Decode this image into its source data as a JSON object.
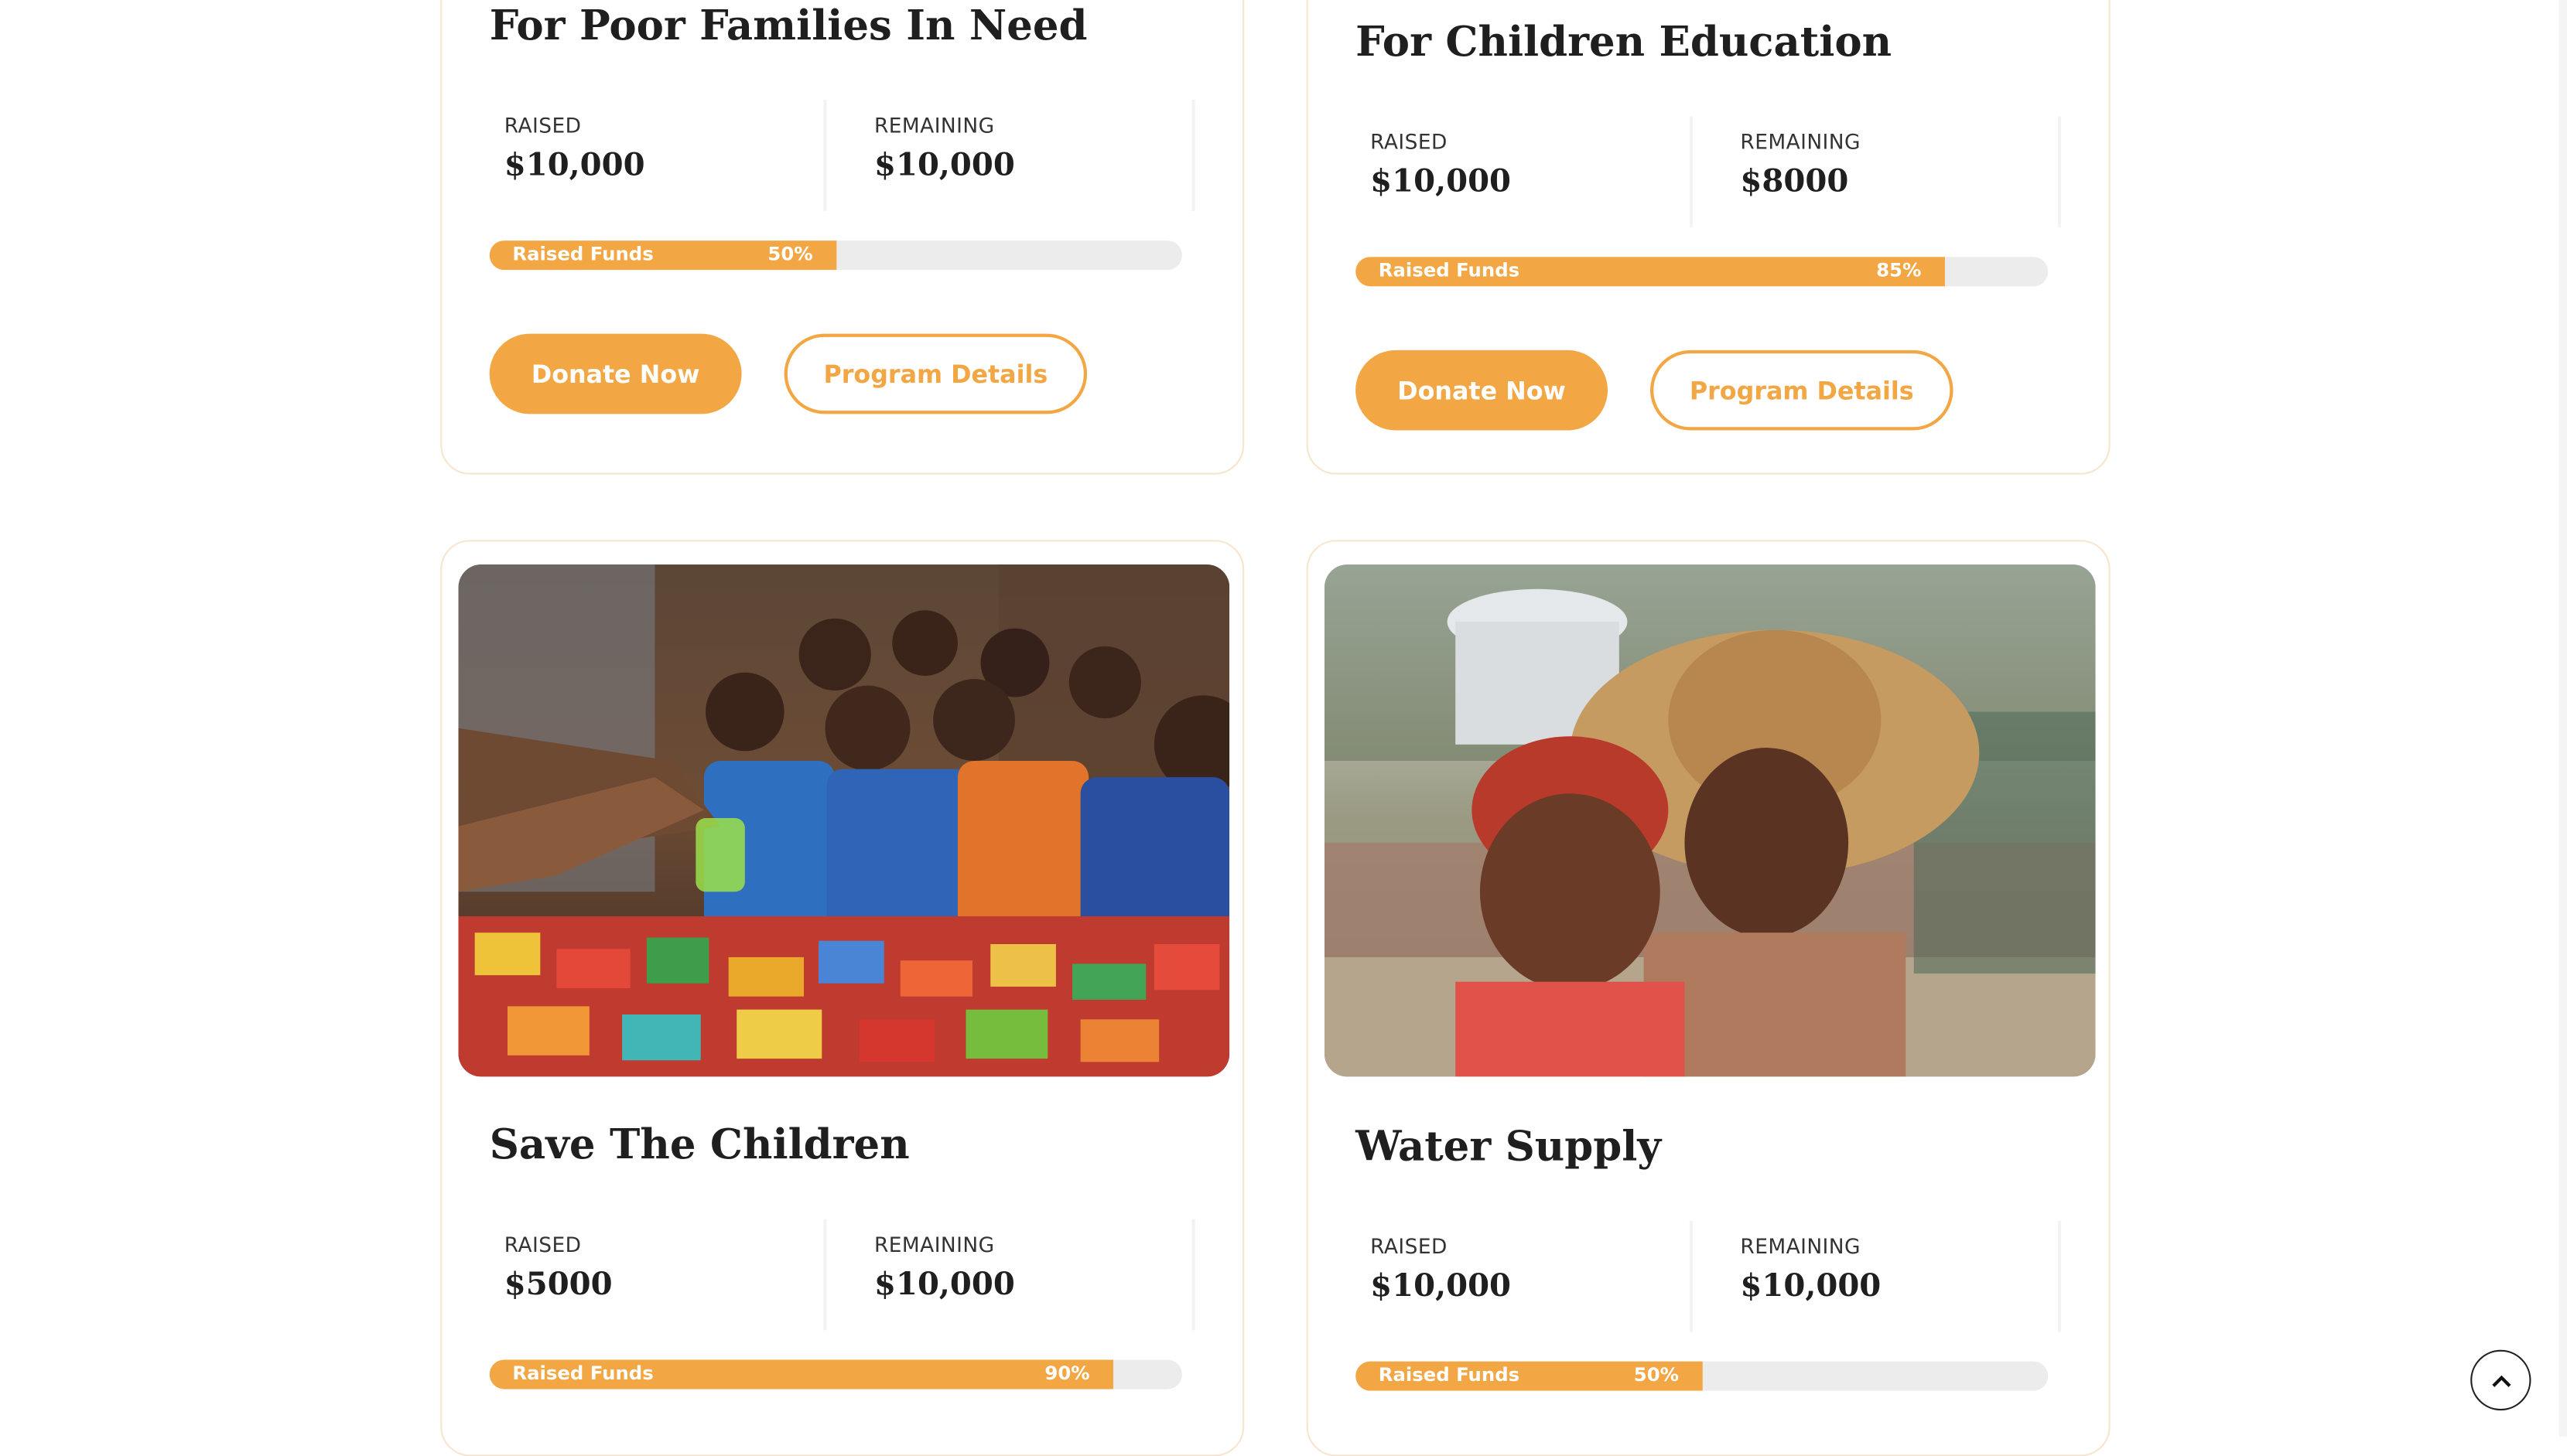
{
  "campaigns": [
    {
      "title": "For Poor Families In Need",
      "raised_label": "RAISED",
      "raised_value": "$10,000",
      "remaining_label": "REMAINING",
      "remaining_value": "$10,000",
      "progress_label": "Raised Funds",
      "progress_text": "50%",
      "progress": 0.5,
      "donate_label": "Donate Now",
      "details_label": "Program Details"
    },
    {
      "title": "For Children Education",
      "raised_label": "RAISED",
      "raised_value": "$10,000",
      "remaining_label": "REMAINING",
      "remaining_value": "$8000",
      "progress_label": "Raised Funds",
      "progress_text": "85%",
      "progress": 0.85,
      "donate_label": "Donate Now",
      "details_label": "Program Details"
    },
    {
      "title": "Save The Children",
      "image": "children-receiving-food-photo",
      "raised_label": "RAISED",
      "raised_value": "$5000",
      "remaining_label": "REMAINING",
      "remaining_value": "$10,000",
      "progress_label": "Raised Funds",
      "progress_text": "90%",
      "progress": 0.9
    },
    {
      "title": "Water Supply",
      "image": "two-children-portrait-photo",
      "raised_label": "RAISED",
      "raised_value": "$10,000",
      "remaining_label": "REMAINING",
      "remaining_value": "$10,000",
      "progress_label": "Raised Funds",
      "progress_text": "50%",
      "progress": 0.5
    }
  ],
  "scroll_to_top": {
    "icon": "chevron-up-icon"
  },
  "colors": {
    "accent": "#f2a744",
    "track": "#ececec",
    "card_border": "#f7e5cf"
  }
}
